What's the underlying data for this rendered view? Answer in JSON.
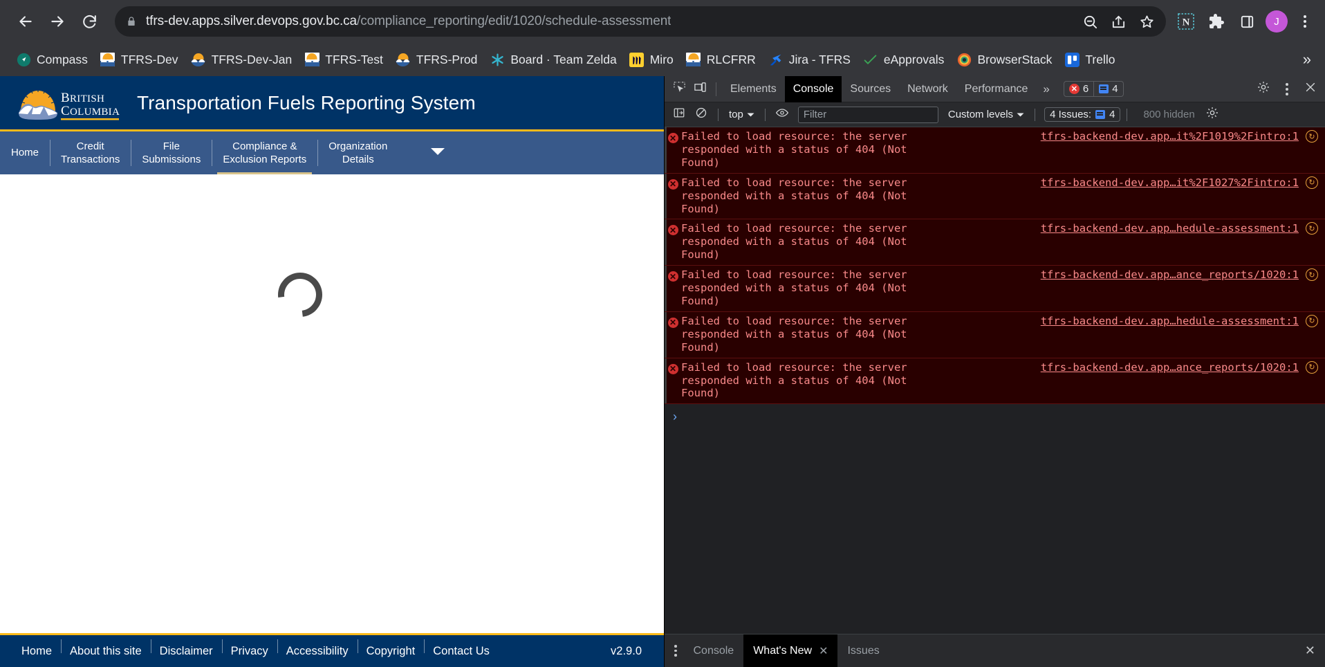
{
  "browser": {
    "back_icon": "back-arrow-icon",
    "forward_icon": "forward-arrow-icon",
    "reload_icon": "reload-icon",
    "lock_icon": "lock-icon",
    "url_host": "tfrs-dev.apps.silver.devops.gov.bc.ca",
    "url_path": "/compliance_reporting/edit/1020/schedule-assessment",
    "url_full": "tfrs-dev.apps.silver.devops.gov.bc.ca/compliance_reporting/edit/1020/schedule-assessment",
    "actions": [
      "zoom-out-icon",
      "share-icon",
      "bookmark-star-icon"
    ],
    "extensions": [
      "notion-extension-icon",
      "puzzle-extensions-icon",
      "side-panel-icon"
    ],
    "avatar_letter": "J",
    "menu_icon": "three-dots-menu-icon",
    "bookmarks": [
      {
        "label": "Compass",
        "icon": "compass-icon"
      },
      {
        "label": "TFRS-Dev",
        "icon": "bc-flag-icon"
      },
      {
        "label": "TFRS-Dev-Jan",
        "icon": "bc-flag-round-icon"
      },
      {
        "label": "TFRS-Test",
        "icon": "bc-flag-icon"
      },
      {
        "label": "TFRS-Prod",
        "icon": "bc-flag-round-icon"
      },
      {
        "label": "Board · Team Zelda",
        "icon": "asterisk-icon"
      },
      {
        "label": "Miro",
        "icon": "miro-icon"
      },
      {
        "label": "RLCFRR",
        "icon": "bc-flag-icon"
      },
      {
        "label": "Jira - TFRS",
        "icon": "jira-icon"
      },
      {
        "label": "eApprovals",
        "icon": "checkmark-icon"
      },
      {
        "label": "BrowserStack",
        "icon": "browserstack-icon"
      },
      {
        "label": "Trello",
        "icon": "trello-icon"
      }
    ],
    "bookmarks_overflow": "»"
  },
  "app": {
    "logo_text_line1": "BRITISH",
    "logo_text_line2": "COLUMBIA",
    "title": "Transportation Fuels Reporting System",
    "nav": [
      {
        "label": "Home",
        "active": false
      },
      {
        "label": "Credit\nTransactions",
        "active": false
      },
      {
        "label": "File\nSubmissions",
        "active": false
      },
      {
        "label": "Compliance &\nExclusion Reports",
        "active": true
      },
      {
        "label": "Organization\nDetails",
        "active": false
      }
    ],
    "nav_caret_icon": "chevron-down-icon",
    "loading_spinner": "loading-spinner",
    "footer_links": [
      "Home",
      "About this site",
      "Disclaimer",
      "Privacy",
      "Accessibility",
      "Copyright",
      "Contact Us"
    ],
    "version": "v2.9.0",
    "colors": {
      "header": "#003366",
      "nav": "#38598a",
      "accent": "#fcba19"
    }
  },
  "devtools": {
    "inspect_icon": "inspect-element-icon",
    "device_icon": "device-toolbar-icon",
    "tabs": [
      "Elements",
      "Console",
      "Sources",
      "Network",
      "Performance"
    ],
    "active_tab": "Console",
    "more_tabs_icon": "chevron-double-right-icon",
    "error_count": "6",
    "message_count": "4",
    "settings_icon": "gear-icon",
    "kebab_icon": "three-dots-menu-icon",
    "close_icon": "close-icon",
    "filterbar": {
      "sidebar_icon": "console-sidebar-icon",
      "clear_icon": "clear-console-icon",
      "context": "top",
      "context_caret": "chevron-down-icon",
      "eye_icon": "live-expression-icon",
      "filter_placeholder": "Filter",
      "levels_label": "Custom levels",
      "levels_caret": "chevron-down-icon",
      "issues_label": "4 Issues:",
      "issues_count": "4",
      "hidden_label": "800 hidden",
      "settings_icon": "gear-icon"
    },
    "logs": [
      {
        "message": "Failed to load resource: the server\nresponded with a status of 404 (Not Found)",
        "source": "tfrs-backend-dev.app…it%2F1019%2Fintro:1"
      },
      {
        "message": "Failed to load resource: the server\nresponded with a status of 404 (Not Found)",
        "source": "tfrs-backend-dev.app…it%2F1027%2Fintro:1"
      },
      {
        "message": "Failed to load resource: the server\nresponded with a status of 404 (Not Found)",
        "source": "tfrs-backend-dev.app…hedule-assessment:1"
      },
      {
        "message": "Failed to load resource: the server\nresponded with a status of 404 (Not Found)",
        "source": "tfrs-backend-dev.app…ance_reports/1020:1"
      },
      {
        "message": "Failed to load resource: the server\nresponded with a status of 404 (Not Found)",
        "source": "tfrs-backend-dev.app…hedule-assessment:1"
      },
      {
        "message": "Failed to load resource: the server\nresponded with a status of 404 (Not Found)",
        "source": "tfrs-backend-dev.app…ance_reports/1020:1"
      }
    ],
    "prompt": "›",
    "drawer": {
      "kebab_icon": "three-dots-menu-icon",
      "tabs": [
        "Console",
        "What's New",
        "Issues"
      ],
      "active_tab": "What's New",
      "tab_close": "✕",
      "close": "✕"
    }
  }
}
